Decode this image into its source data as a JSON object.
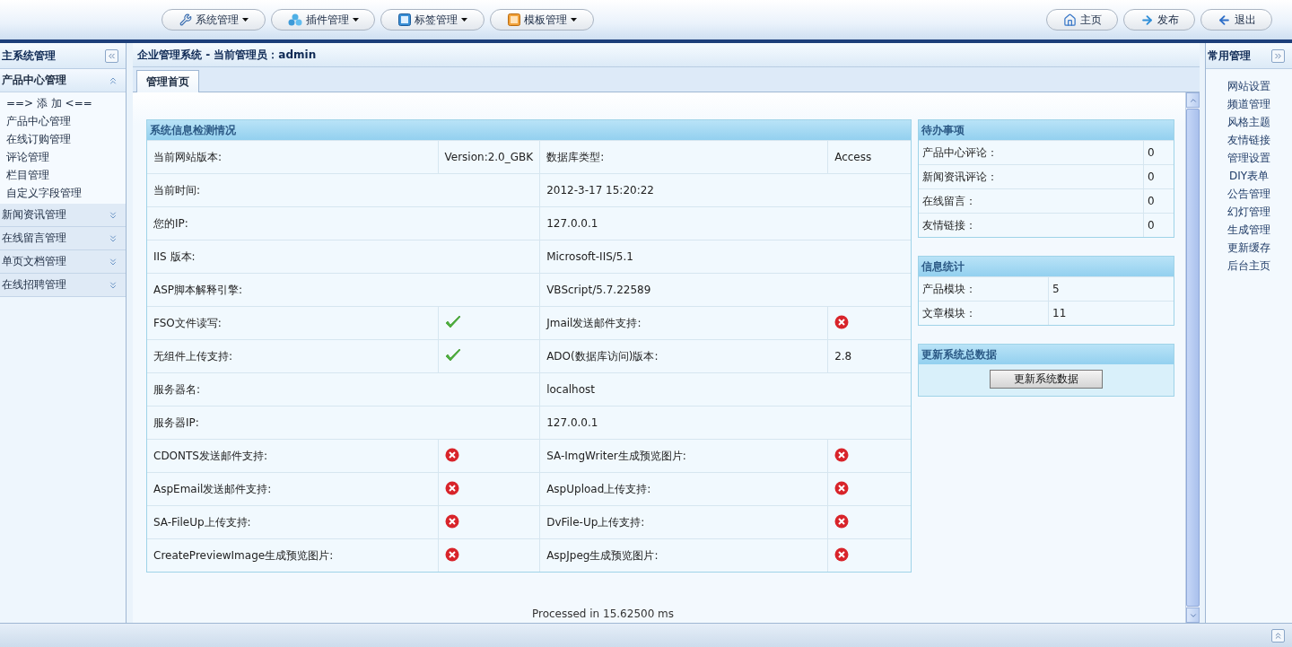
{
  "top_menu": [
    {
      "label": "系统管理"
    },
    {
      "label": "插件管理"
    },
    {
      "label": "标签管理"
    },
    {
      "label": "模板管理"
    }
  ],
  "top_actions": [
    {
      "label": "主页"
    },
    {
      "label": "发布"
    },
    {
      "label": "退出"
    }
  ],
  "left_sidebar": {
    "title": "主系统管理",
    "groups": [
      {
        "label": "产品中心管理",
        "expanded": true,
        "children": [
          "==> 添 加 <==",
          "产品中心管理",
          "在线订购管理",
          "评论管理",
          "栏目管理",
          "自定义字段管理"
        ]
      },
      {
        "label": "新闻资讯管理",
        "expanded": false
      },
      {
        "label": "在线留言管理",
        "expanded": false
      },
      {
        "label": "单页文档管理",
        "expanded": false
      },
      {
        "label": "在线招聘管理",
        "expanded": false
      }
    ]
  },
  "main": {
    "title": "企业管理系统 - 当前管理员：admin",
    "tabs": [
      {
        "label": "管理首页",
        "selected": true
      }
    ],
    "system_info": {
      "title": "系统信息检测情况",
      "rows": [
        {
          "kind": "quad",
          "cells": [
            {
              "text": "当前网站版本:"
            },
            {
              "text": "Version:2.0_GBK"
            },
            {
              "text": "数据库类型:"
            },
            {
              "text": "Access"
            }
          ]
        },
        {
          "kind": "wide",
          "cells": [
            {
              "text": "当前时间:",
              "colspan": 2
            },
            {
              "text": "2012-3-17 15:20:22",
              "colspan": 2
            }
          ]
        },
        {
          "kind": "wide",
          "cells": [
            {
              "text": "您的IP:",
              "colspan": 2
            },
            {
              "text": "127.0.0.1",
              "colspan": 2
            }
          ]
        },
        {
          "kind": "wide",
          "cells": [
            {
              "text": "IIS 版本:",
              "colspan": 2
            },
            {
              "text": "Microsoft-IIS/5.1",
              "colspan": 2
            }
          ]
        },
        {
          "kind": "wide",
          "cells": [
            {
              "text": "ASP脚本解释引擎:",
              "colspan": 2
            },
            {
              "text": "VBScript/5.7.22589",
              "colspan": 2
            }
          ]
        },
        {
          "kind": "quad",
          "cells": [
            {
              "text": "FSO文件读写:"
            },
            {
              "supported": true
            },
            {
              "text": "Jmail发送邮件支持:"
            },
            {
              "supported": false
            }
          ]
        },
        {
          "kind": "quad",
          "cells": [
            {
              "text": "无组件上传支持:"
            },
            {
              "supported": true
            },
            {
              "text": "ADO(数据库访问)版本:"
            },
            {
              "text": "2.8"
            }
          ]
        },
        {
          "kind": "wide",
          "cells": [
            {
              "text": "服务器名:",
              "colspan": 2
            },
            {
              "text": "localhost",
              "colspan": 2
            }
          ]
        },
        {
          "kind": "wide",
          "cells": [
            {
              "text": "服务器IP:",
              "colspan": 2
            },
            {
              "text": "127.0.0.1",
              "colspan": 2
            }
          ]
        },
        {
          "kind": "quad",
          "cells": [
            {
              "text": "CDONTS发送邮件支持:"
            },
            {
              "supported": false
            },
            {
              "text": "SA-ImgWriter生成预览图片:"
            },
            {
              "supported": false
            }
          ]
        },
        {
          "kind": "quad",
          "cells": [
            {
              "text": "AspEmail发送邮件支持:"
            },
            {
              "supported": false
            },
            {
              "text": "AspUpload上传支持:"
            },
            {
              "supported": false
            }
          ]
        },
        {
          "kind": "quad",
          "cells": [
            {
              "text": "SA-FileUp上传支持:"
            },
            {
              "supported": false
            },
            {
              "text": "DvFile-Up上传支持:"
            },
            {
              "supported": false
            }
          ]
        },
        {
          "kind": "quad",
          "cells": [
            {
              "text": "CreatePreviewImage生成预览图片:"
            },
            {
              "supported": false
            },
            {
              "text": "AspJpeg生成预览图片:"
            },
            {
              "supported": false
            }
          ]
        }
      ]
    },
    "todo": {
      "title": "待办事项",
      "rows": [
        {
          "label": "产品中心评论：",
          "value": "0"
        },
        {
          "label": "新闻资讯评论：",
          "value": "0"
        },
        {
          "label": "在线留言：",
          "value": "0"
        },
        {
          "label": "友情链接：",
          "value": "0"
        }
      ]
    },
    "stats": {
      "title": "信息统计",
      "rows": [
        {
          "label": "产品模块：",
          "value": "5"
        },
        {
          "label": "文章模块：",
          "value": "11"
        }
      ]
    },
    "update": {
      "title": "更新系统总数据",
      "button": "更新系统数据"
    },
    "footer": "Processed in 15.62500 ms"
  },
  "right_sidebar": {
    "title": "常用管理",
    "items": [
      "网站设置",
      "频道管理",
      "风格主题",
      "友情链接",
      "管理设置",
      "DIY表单",
      "公告管理",
      "幻灯管理",
      "生成管理",
      "更新缓存",
      "后台主页"
    ]
  }
}
